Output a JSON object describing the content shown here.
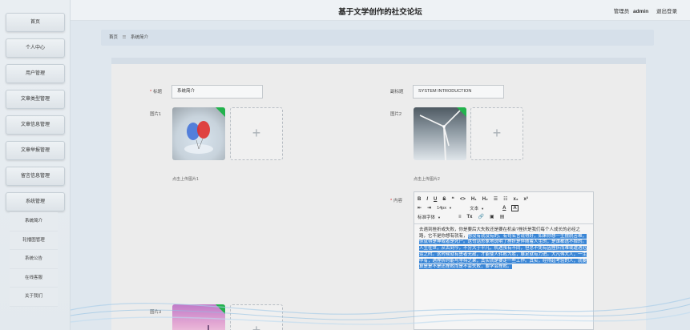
{
  "app": {
    "title": "基于文学创作的社交论坛"
  },
  "user": {
    "role": "管理员",
    "name": "admin",
    "logout": "退出登录"
  },
  "sidebar": {
    "items": [
      {
        "label": "首页"
      },
      {
        "label": "个人中心"
      },
      {
        "label": "用户管理"
      },
      {
        "label": "文章类型管理"
      },
      {
        "label": "文章信息管理"
      },
      {
        "label": "文章举报管理"
      },
      {
        "label": "留言信息管理"
      },
      {
        "label": "系统管理"
      }
    ],
    "submenu": [
      {
        "label": "系统简介"
      },
      {
        "label": "轮播图管理"
      },
      {
        "label": "系统公告"
      },
      {
        "label": "在线客服"
      },
      {
        "label": "关于我们"
      }
    ]
  },
  "breadcrumb": {
    "home": "首页",
    "separator": "☰",
    "current": "系统简介"
  },
  "form": {
    "title_label": "标题",
    "title_value": "系统简介",
    "subtitle_label": "副标题",
    "subtitle_value": "SYSTEM INTRODUCTION",
    "image1_label": "图片1",
    "image1_hint": "点击上传图片1",
    "image2_label": "图片2",
    "image2_hint": "点击上传图片2",
    "image3_label": "图片3",
    "content_label": "内容",
    "upload_plus": "+"
  },
  "editor": {
    "toolbar_row1": [
      "B",
      "I",
      "U",
      "S",
      "❝",
      "<>",
      "H₁",
      "H₂",
      "☰",
      "☷",
      "x₂",
      "x²"
    ],
    "toolbar_row2": {
      "indent_dec": "⇤",
      "indent_inc": "⇥",
      "font_size": "14px",
      "text_type": "文本",
      "font_color": "A",
      "bg_color": "A"
    },
    "toolbar_row3": {
      "font_family": "标准字体",
      "align": "≡",
      "clear": "Tx",
      "link": "🔗",
      "image": "▣",
      "video": "▤"
    },
    "content_plain": "去遇到挫折或失败，你是要后大失败还是要在机会?挫折是我们每个人成长的必经之路，它不是你想有就有，",
    "content_highlight": "想没有就没有的。有句名言说得好，如果你想一生摆脱苦难，你就得是神或者是死尸。这句话形象地说明了挫折是伴随着人生的，是谁都逃不掉的。人生在世，从古到今，不分大于平凡，机遇虽有不同，但总不免有因挫折而难或遭遇厄运之时。这时候就有勇者无敌，才能使人转败为胜，展足就有力进。大凡伟大人，一生中有，遇挫折时能与坚持之果，其实就是要走一些工作。其实，经得起考验的人，就要算是是不是还挫败而是不会失败，要学会挫败。"
  },
  "colors": {
    "highlight": "#3a86d6",
    "corner_badge": "#22b24c",
    "required": "#dd3333"
  }
}
